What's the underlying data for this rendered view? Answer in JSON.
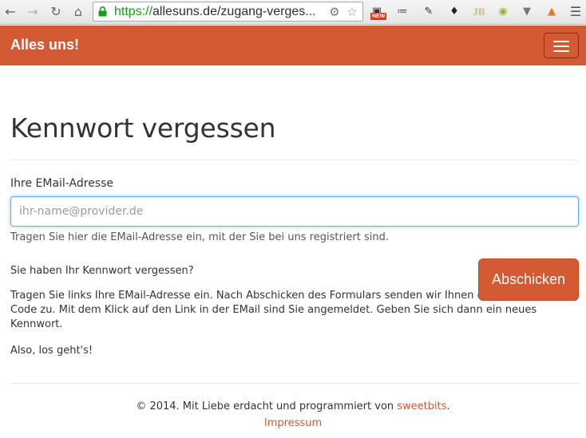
{
  "browser": {
    "url_scheme": "https://",
    "url_rest": "allesuns.de/zugang-verges...",
    "icons": {
      "back": "back-arrow-icon",
      "forward": "forward-arrow-icon",
      "reload": "reload-icon",
      "home": "home-icon",
      "lock": "lock-icon",
      "settings": "gear-icon",
      "bookmark": "star-icon",
      "menu": "menu-icon"
    },
    "extension_badge": "NEW",
    "extension_jb": "JB"
  },
  "navbar": {
    "brand": "Alles uns!",
    "accent_color": "#d35a32"
  },
  "page": {
    "title": "Kennwort vergessen",
    "email_label": "Ihre EMail-Adresse",
    "email_placeholder": "ihr-name@provider.de",
    "email_value": "",
    "email_help": "Tragen Sie hier die EMail-Adresse ein, mit der Sie bei uns registriert sind.",
    "question": "Sie haben Ihr Kennwort vergessen?",
    "description": "Tragen Sie links Ihre EMail-Adresse ein. Nach Abschicken des Formulars senden wir Ihnen einen Zugangs-Code zu. Mit dem Klick auf den Link in der EMail sind Sie angemeldet. Geben Sie sich dann ein neues Kennwort.",
    "lets_go": "Also, los geht's!",
    "submit_label": "Abschicken"
  },
  "footer": {
    "text": "© 2014. Mit Liebe erdacht und programmiert von ",
    "author_link": "sweetbits",
    "text_end": ".",
    "impressum_link": "Impressum"
  }
}
